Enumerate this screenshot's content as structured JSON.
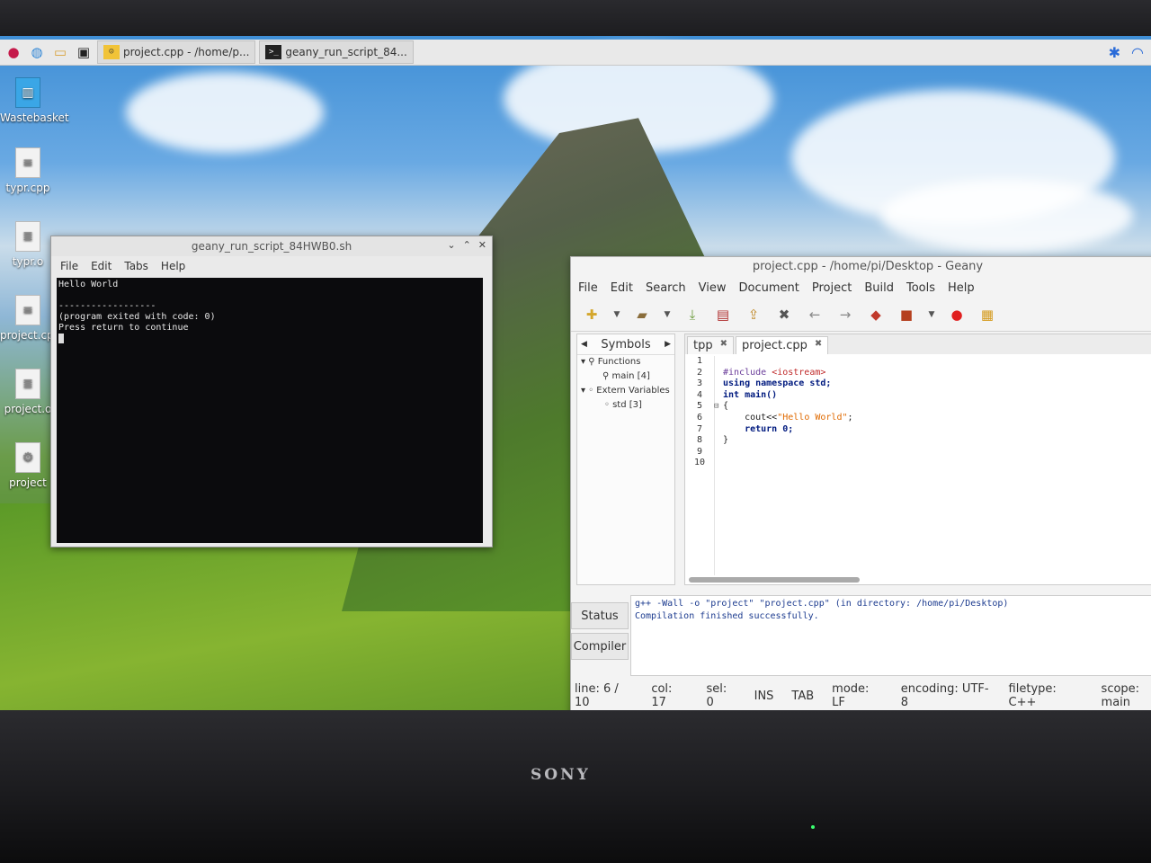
{
  "taskbar": {
    "tasks": [
      {
        "label": "project.cpp - /home/p..."
      },
      {
        "label": "geany_run_script_84..."
      }
    ]
  },
  "desktop": {
    "icons": [
      {
        "label": "Wastebasket"
      },
      {
        "label": "typr.cpp"
      },
      {
        "label": "typr.o"
      },
      {
        "label": "project.cpp"
      },
      {
        "label": "project.o"
      },
      {
        "label": "project"
      }
    ]
  },
  "terminal": {
    "title": "geany_run_script_84HWB0.sh",
    "menu": [
      "File",
      "Edit",
      "Tabs",
      "Help"
    ],
    "output": "Hello World\n\n------------------\n(program exited with code: 0)\nPress return to continue\n"
  },
  "geany": {
    "title": "project.cpp - /home/pi/Desktop - Geany",
    "menu": [
      "File",
      "Edit",
      "Search",
      "View",
      "Document",
      "Project",
      "Build",
      "Tools",
      "Help"
    ],
    "sidebar_tab": "Symbols",
    "symbols": {
      "functions_label": "Functions",
      "function_item": "main [4]",
      "extern_label": "Extern Variables",
      "extern_item": "std [3]"
    },
    "tabs": [
      {
        "label": "tpp"
      },
      {
        "label": "project.cpp"
      }
    ],
    "line_numbers": [
      "1",
      "2",
      "3",
      "4",
      "5",
      "6",
      "7",
      "8",
      "9",
      "10"
    ],
    "code": {
      "l2_pp": "#include ",
      "l2_inc": "<iostream>",
      "l3": "using namespace std;",
      "l4": "int main()",
      "l5": "{",
      "l6_a": "    cout<<",
      "l6_str": "\"Hello World\"",
      "l6_b": ";",
      "l7": "    return 0;",
      "l8": "}"
    },
    "bottom_tabs": [
      "Status",
      "Compiler"
    ],
    "compiler_output": "g++ -Wall -o \"project\" \"project.cpp\" (in directory: /home/pi/Desktop)\nCompilation finished successfully.",
    "status": {
      "line": "line: 6 / 10",
      "col": "col: 17",
      "sel": "sel: 0",
      "ins": "INS",
      "tab": "TAB",
      "mode": "mode: LF",
      "encoding": "encoding: UTF-8",
      "filetype": "filetype: C++",
      "scope": "scope: main"
    }
  },
  "monitor": {
    "brand": "SONY"
  }
}
